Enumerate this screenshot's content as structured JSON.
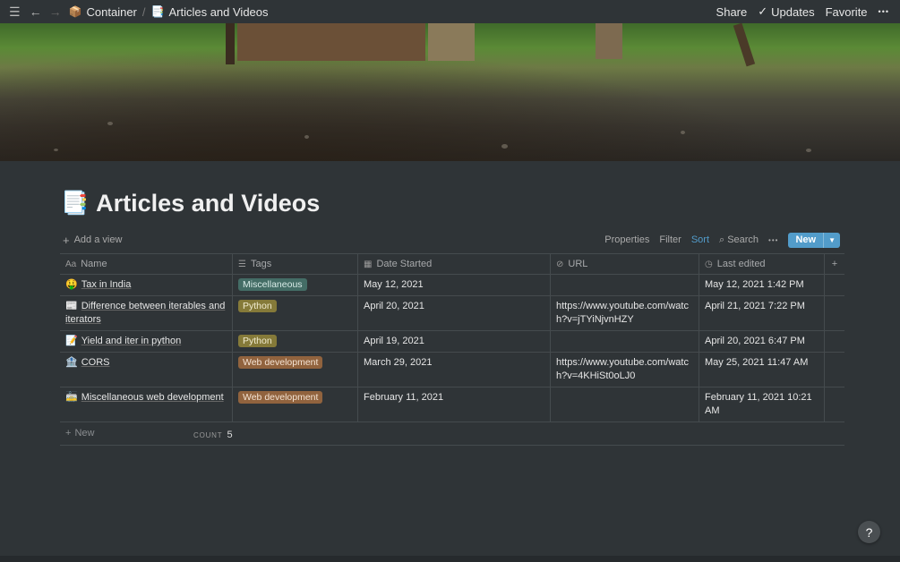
{
  "topbar": {
    "crumbs": [
      {
        "emoji": "📦",
        "label": "Container"
      },
      {
        "emoji": "📑",
        "label": "Articles and Videos"
      }
    ],
    "separator": "/",
    "share": "Share",
    "updates": "Updates",
    "favorite": "Favorite",
    "more": "•••"
  },
  "page": {
    "emoji": "📑",
    "title": "Articles and Videos"
  },
  "viewbar": {
    "add_view": "Add a view",
    "properties": "Properties",
    "filter": "Filter",
    "sort": "Sort",
    "search": "Search",
    "more": "•••",
    "new": "New"
  },
  "table": {
    "columns": [
      {
        "icon": "Aa",
        "label": "Name"
      },
      {
        "icon": "☰",
        "label": "Tags"
      },
      {
        "icon": "▦",
        "label": "Date Started"
      },
      {
        "icon": "⊘",
        "label": "URL"
      },
      {
        "icon": "◷",
        "label": "Last edited"
      }
    ],
    "rows": [
      {
        "emoji": "🤑",
        "name": "Tax in India",
        "tag": "Miscellaneous",
        "date": "May 12, 2021",
        "url": "",
        "edited": "May 12, 2021 1:42 PM"
      },
      {
        "emoji": "📰",
        "name": "Difference between iterables and iterators",
        "tag": "Python",
        "date": "April 20, 2021",
        "url": "https://www.youtube.com/watch?v=jTYiNjvnHZY",
        "edited": "April 21, 2021 7:22 PM"
      },
      {
        "emoji": "📝",
        "name": "Yield and iter in python",
        "tag": "Python",
        "date": "April 19, 2021",
        "url": "",
        "edited": "April 20, 2021 6:47 PM"
      },
      {
        "emoji": "🏦",
        "name": "CORS",
        "tag": "Web development",
        "date": "March 29, 2021",
        "url": "https://www.youtube.com/watch?v=4KHiSt0oLJ0",
        "edited": "May 25, 2021 11:47 AM"
      },
      {
        "emoji": "🚋",
        "name": "Miscellaneous web development",
        "tag": "Web development",
        "date": "February 11, 2021",
        "url": "",
        "edited": "February 11, 2021 10:21 AM"
      }
    ],
    "new_row": "New",
    "add_column": "+"
  },
  "footer": {
    "count_label": "COUNT",
    "count_value": "5"
  },
  "help": "?",
  "colors": {
    "accent": "#529cca",
    "background": "#2f3437"
  }
}
